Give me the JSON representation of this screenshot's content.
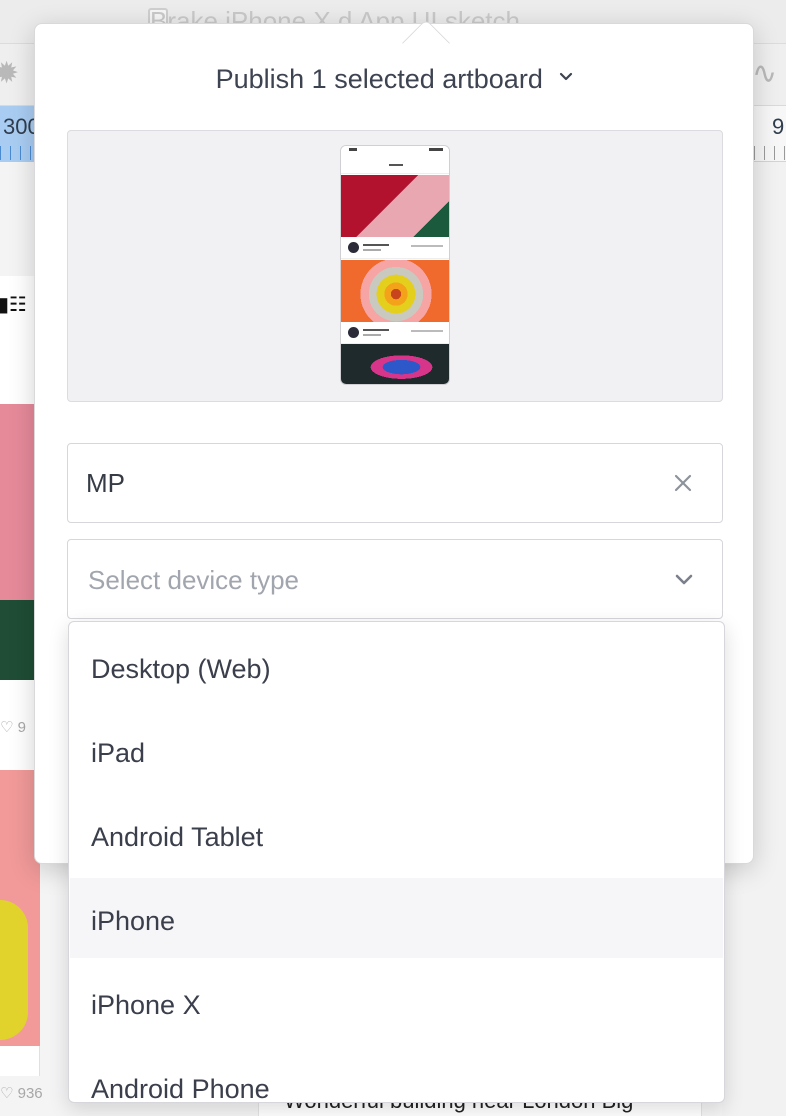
{
  "background": {
    "document_title": "Brake iPhone X                d App UI sketch",
    "ruler_left": "300",
    "ruler_right": "9",
    "like_count_1": "9",
    "like_count_2": "936",
    "bottom_caption": "Wonderful building near London Big"
  },
  "popover": {
    "title": "Publish 1 selected artboard",
    "name_field": {
      "value": "MP"
    },
    "device_field": {
      "placeholder": "Select device type"
    }
  },
  "device_options": [
    {
      "label": "Desktop (Web)"
    },
    {
      "label": "iPad"
    },
    {
      "label": "Android Tablet"
    },
    {
      "label": "iPhone",
      "highlighted": true
    },
    {
      "label": "iPhone X"
    },
    {
      "label": "Android Phone"
    }
  ],
  "colors": {
    "accent_text": "#3d4350",
    "placeholder": "#a1a5ad",
    "hover_row": "#f6f6f8"
  },
  "icons": [
    "chevron-down-icon",
    "close-icon",
    "wifi-icon",
    "heart-icon",
    "gear-icon"
  ]
}
